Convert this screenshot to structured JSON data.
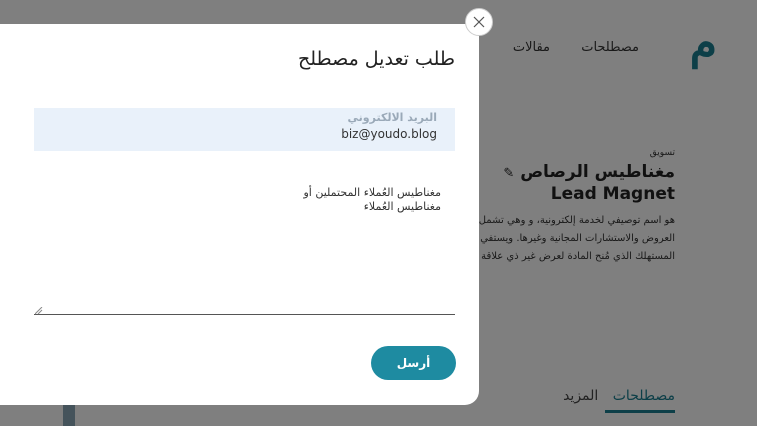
{
  "background": {
    "logo_glyph": "م",
    "nav": {
      "terms": "مصطلحات",
      "articles": "مقالات"
    },
    "category": "تسويق",
    "title_ar": "مغناطيس الرصاص",
    "title_en": "Lead Magnet",
    "paragraph": "هو اسم توصيفي لخدمة إلكترونية، و وهي تشمل نطاقاً واسعاً من العروض والاستشارات المجانية وغيرها. ويستفي خلال كسب المستهلك الذي مُنح المادة لعرض غير ذي علاقة بالعرض الأساسي",
    "tabs": {
      "terms": "مصطلحات",
      "more": "المزيد"
    },
    "accent_color": "#1a7f90"
  },
  "modal": {
    "title": "طلب تعديل مصطلح",
    "email_label": "البريد الالكتروني",
    "email_value": "biz@youdo.blog",
    "textarea_value": "مغناطيس العُملاء المحتملين أو\nمغناطيس العُملاء",
    "send_label": "أرسل",
    "close_icon": "close-icon",
    "button_color": "#1e8ba1"
  }
}
